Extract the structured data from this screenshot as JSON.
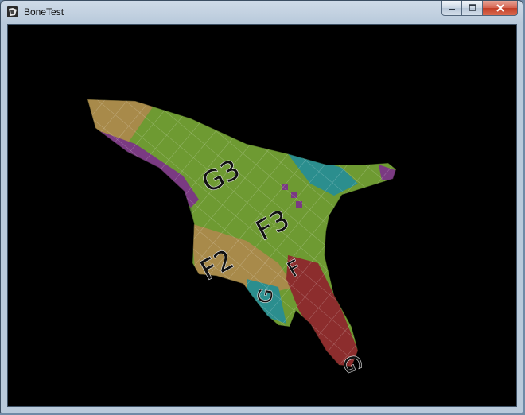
{
  "window": {
    "title": "BoneTest",
    "icon": "app-icon",
    "controls": [
      "minimize-icon",
      "maximize-icon",
      "close-icon"
    ]
  },
  "scene": {
    "background": "#000000",
    "model_labels": [
      "G3",
      "F3",
      "F2",
      "G",
      "F",
      "G"
    ],
    "colors": {
      "green": "#6e9a32",
      "tan": "#a88a4a",
      "purple": "#7a3a82",
      "teal": "#2b8e8e",
      "red": "#8c2d2d"
    }
  }
}
